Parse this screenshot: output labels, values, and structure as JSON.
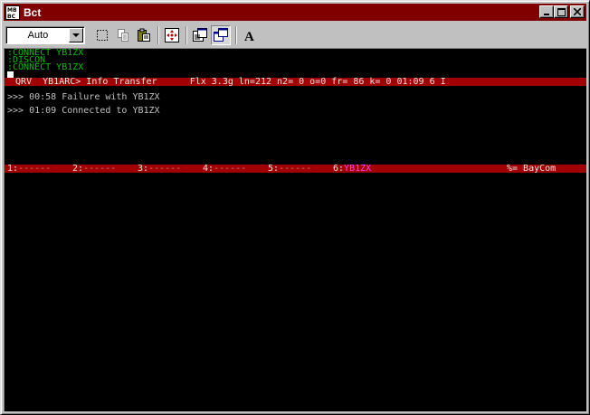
{
  "window": {
    "title": "Bct",
    "app_icon_text": "MB\nBC",
    "minimize_glyph": "_",
    "maximize_glyph": "□",
    "close_glyph": "✕"
  },
  "toolbar": {
    "font_combo_value": "Auto",
    "buttons": [
      {
        "icon": "select-all-icon"
      },
      {
        "icon": "copy-icon"
      },
      {
        "icon": "paste-icon"
      },
      {
        "icon": "connect-icon"
      },
      {
        "icon": "properties-icon"
      },
      {
        "icon": "windows-icon",
        "pressed": true
      },
      {
        "icon": "font-icon",
        "glyph": "A"
      }
    ]
  },
  "terminal": {
    "command_lines": [
      ":CONNECT YB1ZX",
      ":DISCON",
      ":CONNECT YB1ZX"
    ],
    "status_bar": "  QRV  YB1ARC> Info Transfer      Flx 3.3g ln=212 n2= 0 o=0 fr= 86 k= 0 01:09 6 I",
    "messages": [
      ">>> 00:58 Failure with YB1ZX",
      ">>> 01:09 Connected to YB1ZX"
    ],
    "channel_bar": {
      "channels": [
        {
          "label": "1:",
          "value": "------"
        },
        {
          "label": "2:",
          "value": "------"
        },
        {
          "label": "3:",
          "value": "------"
        },
        {
          "label": "4:",
          "value": "------"
        },
        {
          "label": "5:",
          "value": "------"
        },
        {
          "label": "6:",
          "value": "YB1ZX",
          "active": true
        }
      ],
      "right_text": "%= BayCom"
    }
  },
  "colors": {
    "title_bar": "#800000",
    "status_bar": "#a00000",
    "command_text": "#00c000",
    "active_channel": "#ff40ff"
  }
}
